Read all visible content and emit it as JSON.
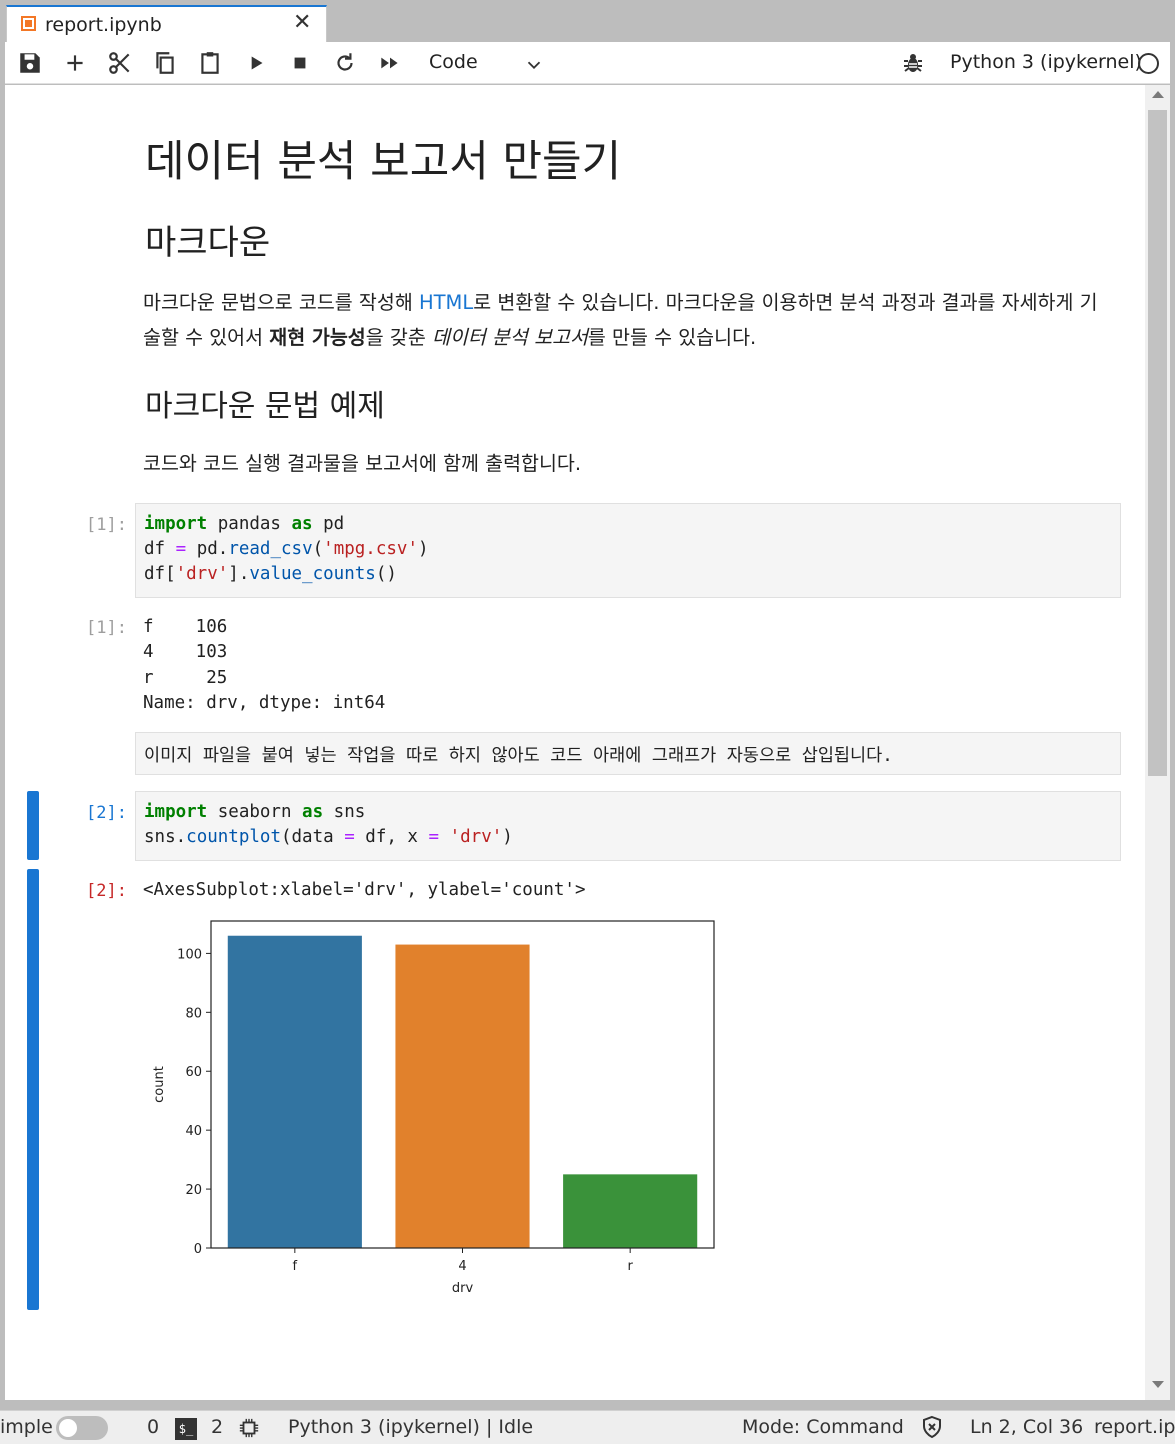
{
  "tab": {
    "title": "report.ipynb",
    "close_icon": "close-icon"
  },
  "toolbar": {
    "buttons": [
      "save",
      "add-cell",
      "cut",
      "copy",
      "paste",
      "run",
      "stop",
      "restart",
      "run-all"
    ],
    "cell_type": "Code",
    "kernel_name": "Python 3 (ipykernel)"
  },
  "markdown": {
    "h1": "데이터 분석 보고서 만들기",
    "h2": "마크다운",
    "para_part1": "마크다운 문법으로 코드를 작성해 ",
    "para_link": "HTML",
    "para_part2": "로 변환할 수 있습니다. 마크다운을 이용하면 분석 과정과 결과를 자세하게 기술할 수 있어서 ",
    "para_bold": "재현 가능성",
    "para_part3": "을 갖춘 ",
    "para_italic": "데이터 분석 보고서",
    "para_part4": "를 만들 수 있습니다.",
    "h3": "마크다운 문법 예제",
    "para2": "코드와 코드 실행 결과물을 보고서에 함께 출력합니다."
  },
  "cells": {
    "c1_in_prompt": "[1]:",
    "c1_out_prompt": "[1]:",
    "c1_output": [
      "f    106",
      "4    103",
      "r     25",
      "Name: drv, dtype: int64"
    ],
    "raw_text": "이미지 파일을 붙여 넣는 작업을 따로 하지 않아도 코드 아래에 그래프가 자동으로 삽입됩니다.",
    "c2_in_prompt": "[2]:",
    "c2_out_prompt": "[2]:",
    "c2_output_text": "<AxesSubplot:xlabel='drv', ylabel='count'>"
  },
  "chart_data": {
    "type": "bar",
    "categories": [
      "f",
      "4",
      "r"
    ],
    "values": [
      106,
      103,
      25
    ],
    "colors": [
      "#3274a1",
      "#e1812c",
      "#3a923a"
    ],
    "xlabel": "drv",
    "ylabel": "count",
    "ylim": [
      0,
      111
    ],
    "yticks": [
      0,
      20,
      40,
      60,
      80,
      100
    ]
  },
  "statusbar": {
    "simple_label": "imple",
    "terminals": "0",
    "kernels": "2",
    "kernel_status": "Python 3 (ipykernel) | Idle",
    "mode": "Mode: Command",
    "cursor": "Ln 2, Col 36",
    "file": "report.ipy"
  }
}
